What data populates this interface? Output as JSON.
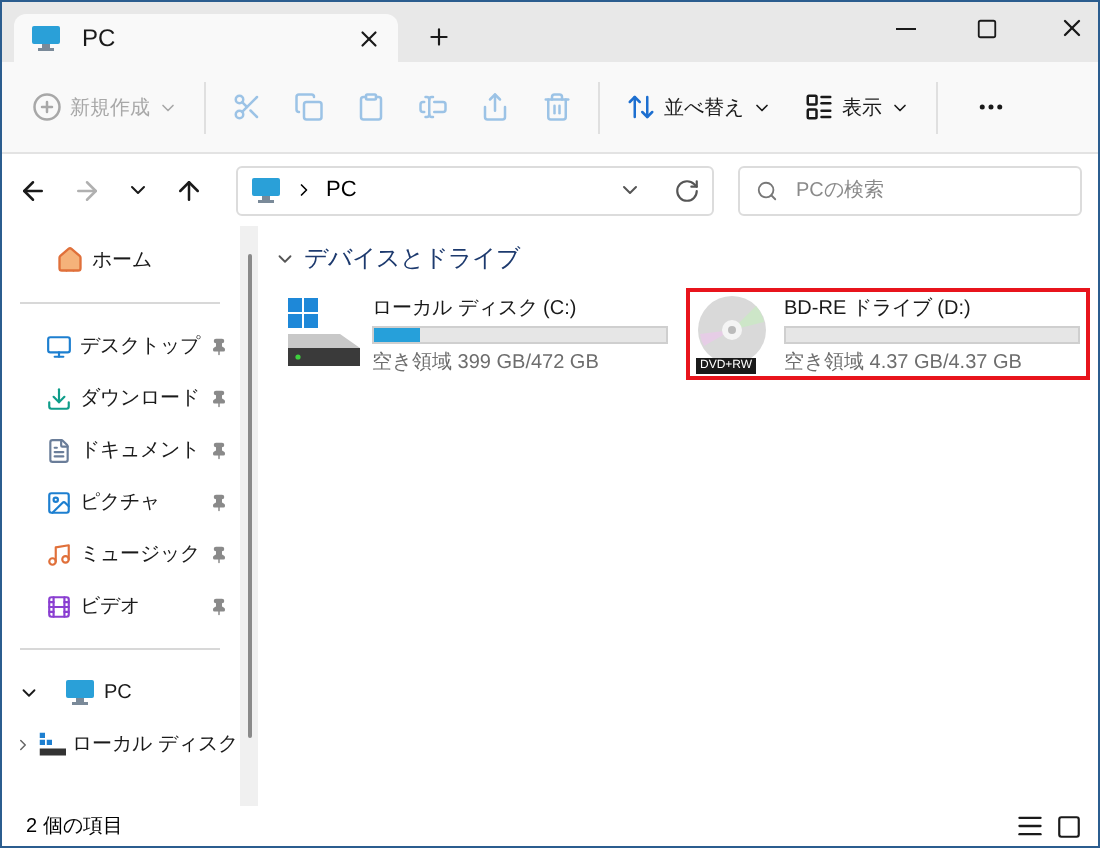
{
  "window": {
    "tab_title": "PC"
  },
  "toolbar": [
    {
      "kind": "new",
      "label": "新規作成",
      "disabled": true
    },
    {
      "kind": "cut",
      "disabled": true
    },
    {
      "kind": "copy",
      "disabled": true
    },
    {
      "kind": "paste",
      "disabled": true
    },
    {
      "kind": "rename",
      "disabled": true
    },
    {
      "kind": "share",
      "disabled": true
    },
    {
      "kind": "delete",
      "disabled": true
    },
    {
      "kind": "sort",
      "label": "並べ替え",
      "disabled": false
    },
    {
      "kind": "view",
      "label": "表示",
      "disabled": false
    },
    {
      "kind": "more",
      "disabled": false
    }
  ],
  "nav": [
    {
      "kind": "back",
      "disabled": false
    },
    {
      "kind": "forward",
      "disabled": true
    },
    {
      "kind": "recent",
      "disabled": false
    },
    {
      "kind": "up",
      "disabled": false
    }
  ],
  "address": {
    "path": "PC"
  },
  "search": {
    "placeholder": "PCの検索"
  },
  "sidebar": {
    "home": "ホーム",
    "pinned": [
      {
        "kind": "desktop",
        "label": "デスクトップ",
        "pinned": true
      },
      {
        "kind": "downloads",
        "label": "ダウンロード",
        "pinned": true
      },
      {
        "kind": "documents",
        "label": "ドキュメント",
        "pinned": true
      },
      {
        "kind": "pictures",
        "label": "ピクチャ",
        "pinned": true
      },
      {
        "kind": "music",
        "label": "ミュージック",
        "pinned": true
      },
      {
        "kind": "videos",
        "label": "ビデオ",
        "pinned": true
      }
    ],
    "tree": [
      {
        "label": "PC",
        "expanded": true,
        "children": [
          {
            "label": "ローカル ディスク",
            "expanded": false
          }
        ]
      }
    ]
  },
  "section": {
    "title": "デバイスとドライブ",
    "expanded": true
  },
  "drives": [
    {
      "kind": "hdd",
      "name": "ローカル ディスク (C:)",
      "level": 0.16,
      "free": "空き領域 399 GB/472 GB",
      "highlighted": false
    },
    {
      "kind": "optical",
      "name": "BD-RE ドライブ (D:)",
      "badge": "DVD+RW",
      "free": "空き領域 4.37 GB/4.37 GB",
      "highlighted": true
    }
  ],
  "status": {
    "count": "2 個の項目"
  }
}
